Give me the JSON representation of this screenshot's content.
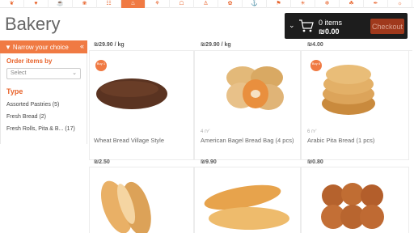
{
  "topnav": {
    "categories": [
      {
        "icon": "❦",
        "active": false
      },
      {
        "icon": "♥",
        "active": false
      },
      {
        "icon": "☕",
        "active": false
      },
      {
        "icon": "❀",
        "active": false
      },
      {
        "icon": "☷",
        "active": false
      },
      {
        "icon": "♨",
        "active": true
      },
      {
        "icon": "⚘",
        "active": false
      },
      {
        "icon": "☖",
        "active": false
      },
      {
        "icon": "♙",
        "active": false
      },
      {
        "icon": "✿",
        "active": false
      },
      {
        "icon": "⚓",
        "active": false
      },
      {
        "icon": "⚑",
        "active": false
      },
      {
        "icon": "☀",
        "active": false
      },
      {
        "icon": "❄",
        "active": false
      },
      {
        "icon": "☘",
        "active": false
      },
      {
        "icon": "✒",
        "active": false
      },
      {
        "icon": "☼",
        "active": false
      }
    ]
  },
  "page": {
    "title": "Bakery"
  },
  "cart": {
    "items_text": "0 items",
    "total": "₪0.00",
    "checkout_label": "Checkout"
  },
  "sidebar": {
    "filter_title": "Narrow your choice",
    "order_by_label": "Order items by",
    "select_placeholder": "Select",
    "type_label": "Type",
    "types": [
      "Assorted Pastries (5)",
      "Fresh Bread (2)",
      "Fresh Rolls, Pita & B... (17)"
    ]
  },
  "products": {
    "row0_prices": [
      "₪29.90 / kg",
      "₪29.90 / kg",
      "₪4.00"
    ],
    "row1": [
      {
        "name": "Wheat Bread Village Style",
        "qty": "",
        "price": "₪2.50",
        "badge": "Buy 1"
      },
      {
        "name": "American Bagel Bread Bag (4 pcs)",
        "qty": "4 יח'",
        "price": "₪9.90",
        "badge": ""
      },
      {
        "name": "Arabic Pita Bread (1 pcs)",
        "qty": "6 יח'",
        "price": "₪0.80",
        "badge": "Buy 6"
      }
    ]
  },
  "colors": {
    "accent": "#f07a43",
    "cart_bg": "#1d1d1d",
    "checkout_bg": "#a0391c"
  }
}
